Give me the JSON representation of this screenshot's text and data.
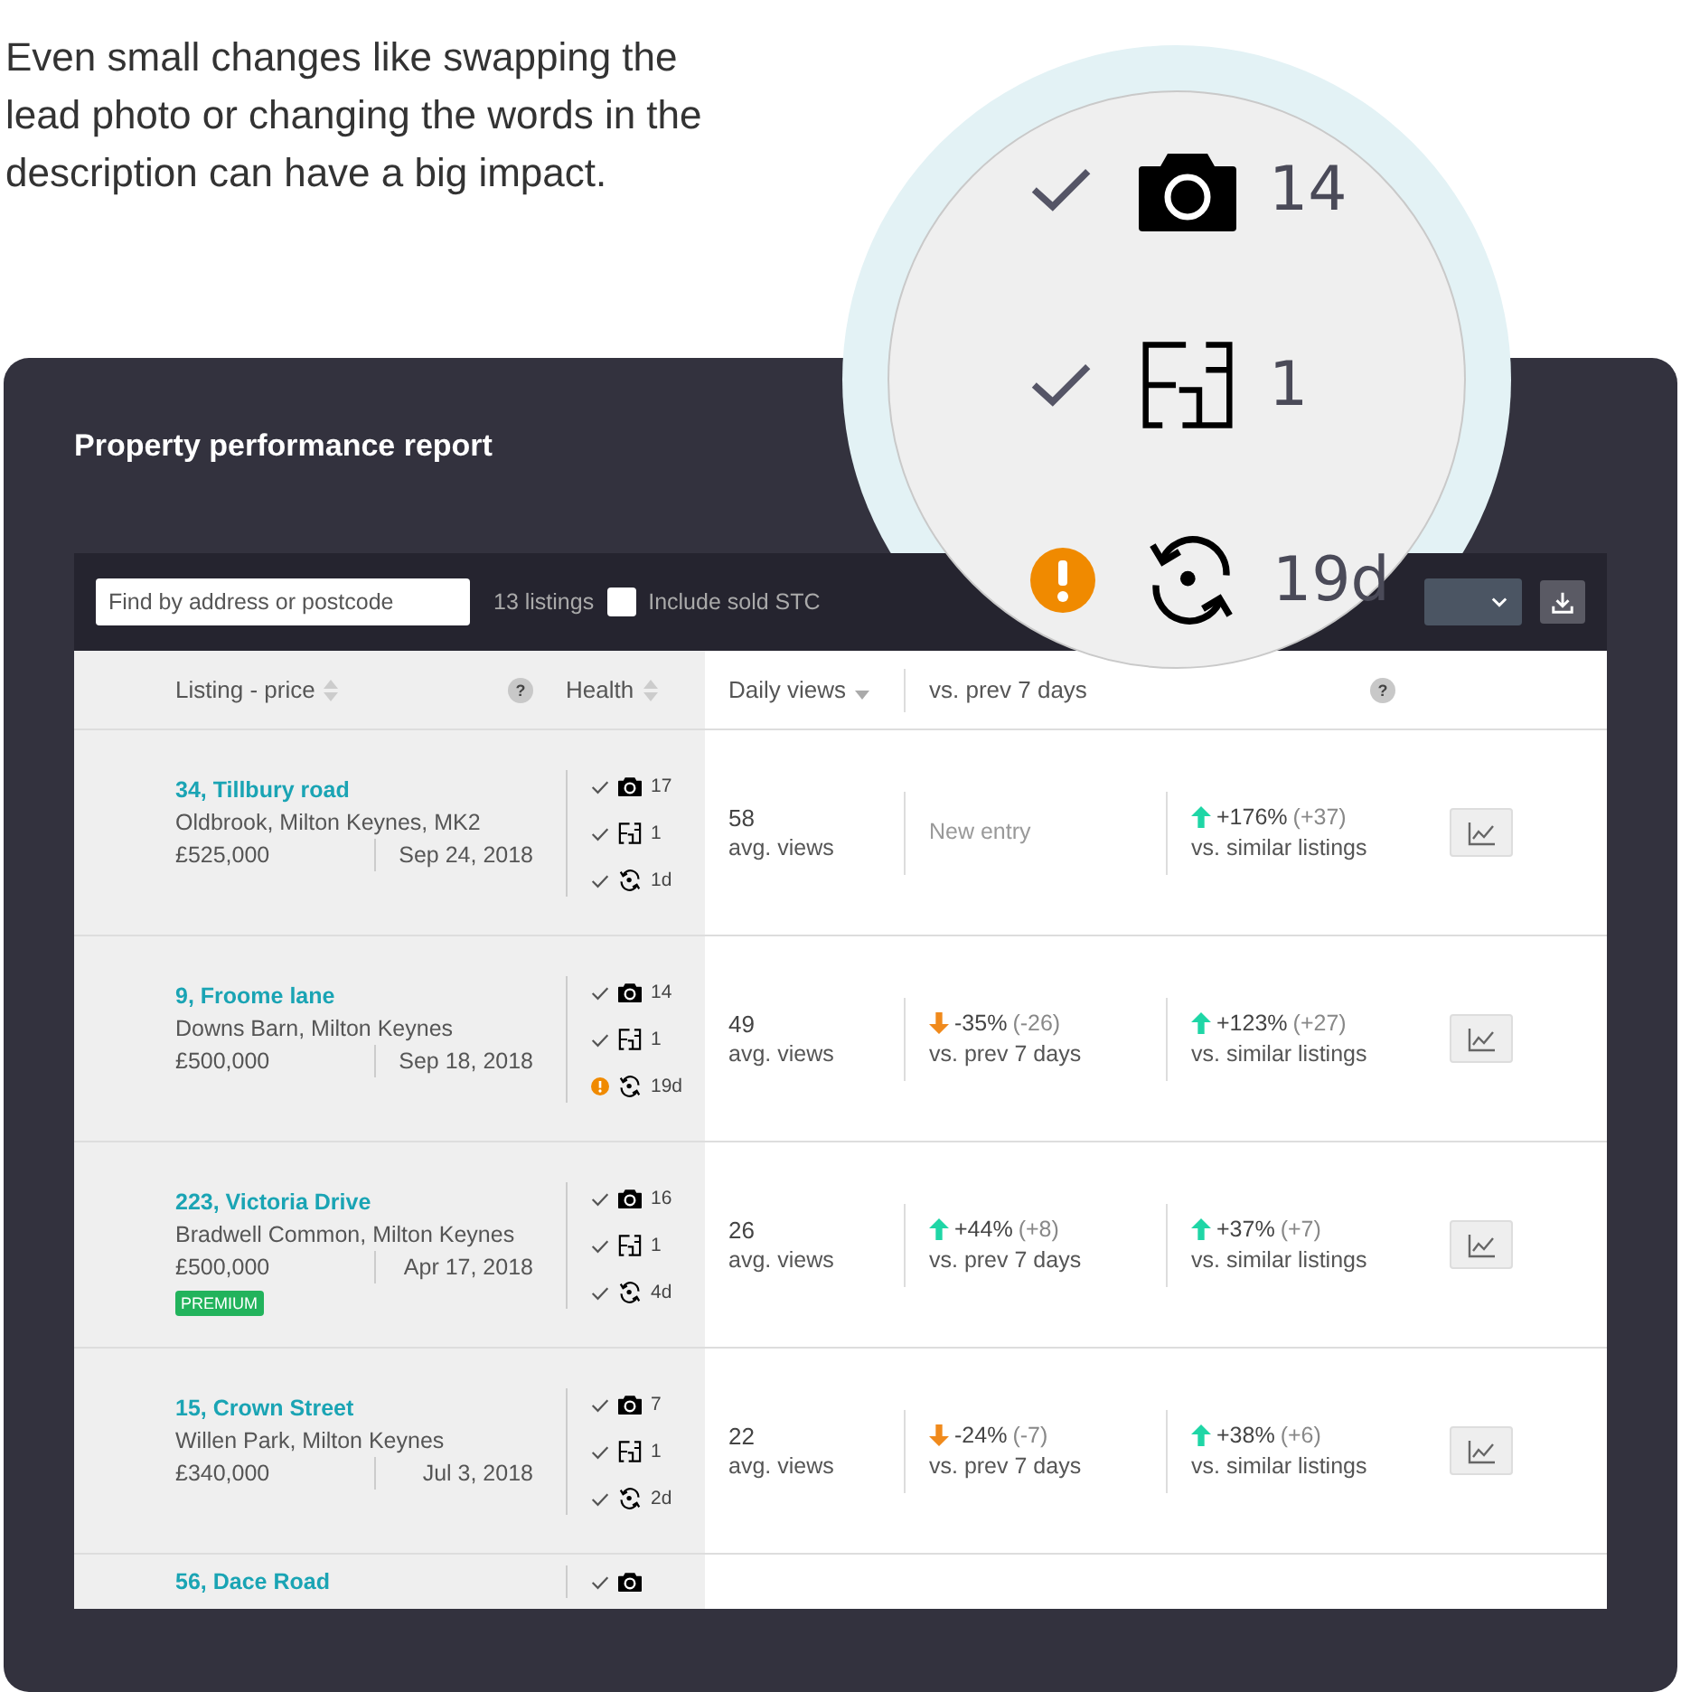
{
  "intro": "Even small changes like swapping the lead photo or changing the words in the description can have a big impact.",
  "magnifier": {
    "items": [
      {
        "kind": "photos",
        "warning": false,
        "value": "14"
      },
      {
        "kind": "floorplan",
        "warning": false,
        "value": "1"
      },
      {
        "kind": "updated",
        "warning": true,
        "value": "19d"
      }
    ]
  },
  "report": {
    "title": "Property performance report",
    "toolbar": {
      "search": {
        "placeholder": "Find by address or postcode"
      },
      "count": "13 listings",
      "include_sold": {
        "label": "Include sold STC",
        "checked": false
      }
    },
    "columns": [
      {
        "label": "Listing - price",
        "sortable": true,
        "sorted": false,
        "help": "?"
      },
      {
        "label": "Health",
        "sortable": true,
        "sorted": false
      },
      {
        "label": "Daily views",
        "sortable": false,
        "sorted": true
      },
      {
        "label": "vs. prev 7 days",
        "sortable": false,
        "sorted": false
      },
      {
        "sortable": false,
        "sorted": false,
        "help": "?"
      }
    ],
    "rows": [
      {
        "name": "34, Tillbury road",
        "area": "Oldbrook, Milton Keynes, MK2",
        "price": "£525,000",
        "date": "Sep 24, 2018",
        "health": [
          {
            "kind": "photos",
            "warning": false,
            "value": "17"
          },
          {
            "kind": "floorplan",
            "warning": false,
            "value": "1"
          },
          {
            "kind": "updated",
            "warning": false,
            "value": "1d"
          }
        ],
        "views": "58",
        "views_label": "avg. views",
        "prev": {
          "kind": "new",
          "text": "New entry"
        },
        "similar": {
          "kind": "change",
          "rising": true,
          "pct": "+176%",
          "delta": "(+37)",
          "label": "vs. similar listings"
        }
      },
      {
        "name": "9, Froome lane",
        "area": "Downs Barn, Milton Keynes",
        "price": "£500,000",
        "date": "Sep 18, 2018",
        "health": [
          {
            "kind": "photos",
            "warning": false,
            "value": "14"
          },
          {
            "kind": "floorplan",
            "warning": false,
            "value": "1"
          },
          {
            "kind": "updated",
            "warning": true,
            "value": "19d"
          }
        ],
        "views": "49",
        "views_label": "avg. views",
        "prev": {
          "kind": "change",
          "rising": false,
          "pct": "-35%",
          "delta": "(-26)",
          "label": "vs. prev 7 days"
        },
        "similar": {
          "kind": "change",
          "rising": true,
          "pct": "+123%",
          "delta": "(+27)",
          "label": "vs. similar listings"
        }
      },
      {
        "name": "223, Victoria Drive",
        "area": "Bradwell Common, Milton Keynes",
        "price": "£500,000",
        "date": "Apr 17, 2018",
        "badge": "PREMIUM",
        "health": [
          {
            "kind": "photos",
            "warning": false,
            "value": "16"
          },
          {
            "kind": "floorplan",
            "warning": false,
            "value": "1"
          },
          {
            "kind": "updated",
            "warning": false,
            "value": "4d"
          }
        ],
        "views": "26",
        "views_label": "avg. views",
        "prev": {
          "kind": "change",
          "rising": true,
          "pct": "+44%",
          "delta": "(+8)",
          "label": "vs. prev 7 days"
        },
        "similar": {
          "kind": "change",
          "rising": true,
          "pct": "+37%",
          "delta": "(+7)",
          "label": "vs. similar listings"
        }
      },
      {
        "name": "15, Crown Street",
        "area": "Willen Park, Milton Keynes",
        "price": "£340,000",
        "date": "Jul 3, 2018",
        "health": [
          {
            "kind": "photos",
            "warning": false,
            "value": "7"
          },
          {
            "kind": "floorplan",
            "warning": false,
            "value": "1"
          },
          {
            "kind": "updated",
            "warning": false,
            "value": "2d"
          }
        ],
        "views": "22",
        "views_label": "avg. views",
        "prev": {
          "kind": "change",
          "rising": false,
          "pct": "-24%",
          "delta": "(-7)",
          "label": "vs. prev 7 days"
        },
        "similar": {
          "kind": "change",
          "rising": true,
          "pct": "+38%",
          "delta": "(+6)",
          "label": "vs. similar listings"
        }
      }
    ],
    "partial_row": {
      "name": "56, Dace Road",
      "health": {
        "kind": "photos",
        "warning": false
      }
    }
  }
}
